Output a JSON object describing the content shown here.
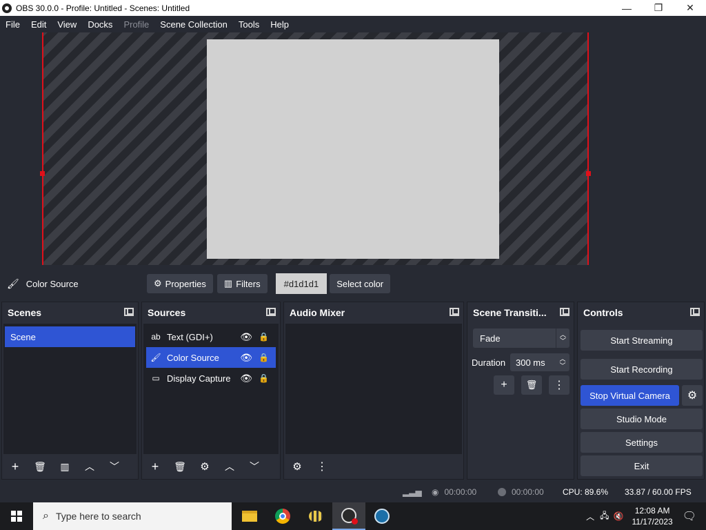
{
  "window": {
    "title": "OBS 30.0.0 - Profile: Untitled - Scenes: Untitled",
    "minimize": "—",
    "restore": "❐",
    "close": "✕"
  },
  "menu": [
    {
      "label": "File",
      "disabled": false
    },
    {
      "label": "Edit",
      "disabled": false
    },
    {
      "label": "View",
      "disabled": false
    },
    {
      "label": "Docks",
      "disabled": false
    },
    {
      "label": "Profile",
      "disabled": true
    },
    {
      "label": "Scene Collection",
      "disabled": false
    },
    {
      "label": "Tools",
      "disabled": false
    },
    {
      "label": "Help",
      "disabled": false
    }
  ],
  "preview": {
    "color": "#d1d1d1",
    "bounds_color": "#e0101a"
  },
  "source_toolbar": {
    "source_name": "Color Source",
    "properties_label": "Properties",
    "filters_label": "Filters",
    "color_value": "#d1d1d1",
    "select_color_label": "Select color"
  },
  "scenes": {
    "title": "Scenes",
    "items": [
      "Scene"
    ]
  },
  "sources": {
    "title": "Sources",
    "items": [
      {
        "icon": "text-icon",
        "glyph": "ab",
        "label": "Text (GDI+)",
        "selected": false
      },
      {
        "icon": "brush-icon",
        "glyph": "🖌",
        "label": "Color Source",
        "selected": true
      },
      {
        "icon": "monitor-icon",
        "glyph": "▭",
        "label": "Display Capture",
        "selected": false
      }
    ]
  },
  "audio_mixer": {
    "title": "Audio Mixer"
  },
  "transitions": {
    "title": "Scene Transiti...",
    "selected": "Fade",
    "duration_label": "Duration",
    "duration_value": "300 ms"
  },
  "controls": {
    "title": "Controls",
    "start_streaming": "Start Streaming",
    "start_recording": "Start Recording",
    "stop_virtual_camera": "Stop Virtual Camera",
    "studio_mode": "Studio Mode",
    "settings": "Settings",
    "exit": "Exit"
  },
  "status": {
    "stream_time": "00:00:00",
    "record_time": "00:00:00",
    "cpu": "CPU: 89.6%",
    "fps": "33.87 / 60.00 FPS"
  },
  "taskbar": {
    "search_placeholder": "Type here to search",
    "time": "12:08 AM",
    "date": "11/17/2023"
  },
  "accent_color": "#2f55d4"
}
